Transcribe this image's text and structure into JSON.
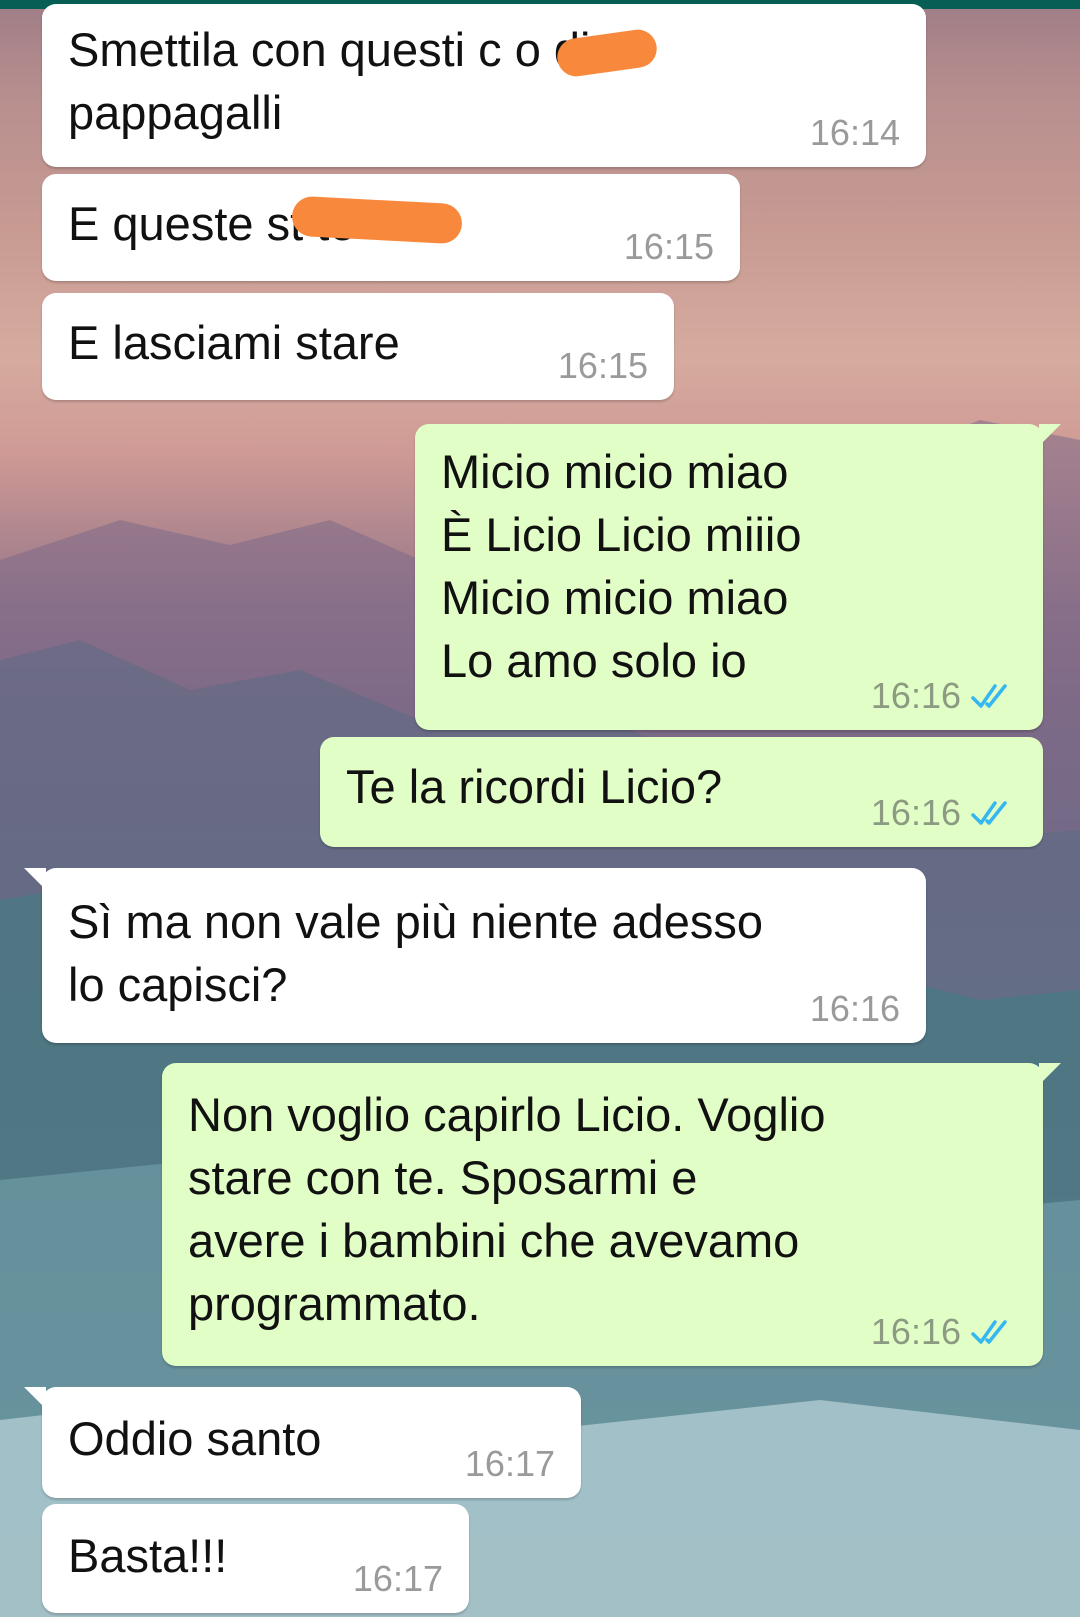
{
  "theme": {
    "incoming_bubble": "#ffffff",
    "outgoing_bubble": "#e1fec6",
    "timestamp_color": "#9a9a9a",
    "read_ticks_color": "#34b7f1",
    "redaction_color": "#f7883c",
    "header_color": "#075e54"
  },
  "chat": {
    "messages": [
      {
        "direction": "incoming",
        "lines": [
          "Smettila con questi c        o di",
          "pappagalli"
        ],
        "time": "16:14",
        "redacted": true
      },
      {
        "direction": "incoming",
        "lines": [
          "E queste st          te"
        ],
        "time": "16:15",
        "redacted": true
      },
      {
        "direction": "incoming",
        "lines": [
          "E lasciami stare"
        ],
        "time": "16:15"
      },
      {
        "direction": "outgoing",
        "lines": [
          "Micio micio miao",
          "È Licio Licio miiio",
          "Micio micio miao",
          "Lo amo solo io"
        ],
        "time": "16:16",
        "status": "read-ticks-icon"
      },
      {
        "direction": "outgoing",
        "lines": [
          "Te la ricordi Licio?"
        ],
        "time": "16:16",
        "status": "read-ticks-icon"
      },
      {
        "direction": "incoming",
        "lines": [
          "Sì ma non vale più niente adesso",
          "lo capisci?"
        ],
        "time": "16:16"
      },
      {
        "direction": "outgoing",
        "lines": [
          "Non voglio capirlo Licio. Voglio",
          "stare con te. Sposarmi e",
          "avere i bambini che avevamo",
          "programmato."
        ],
        "time": "16:16",
        "status": "read-ticks-icon"
      },
      {
        "direction": "incoming",
        "lines": [
          "Oddio santo"
        ],
        "time": "16:17"
      },
      {
        "direction": "incoming",
        "lines": [
          "Basta!!!"
        ],
        "time": "16:17"
      }
    ]
  }
}
